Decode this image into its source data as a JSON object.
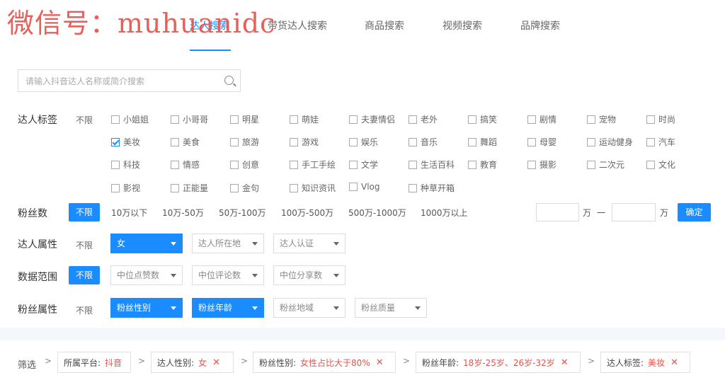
{
  "watermark": "微信号：muhuanidc",
  "tabs": [
    {
      "label": "达人搜索",
      "active": true
    },
    {
      "label": "带货达人搜索",
      "active": false
    },
    {
      "label": "商品搜索",
      "active": false
    },
    {
      "label": "视频搜索",
      "active": false
    },
    {
      "label": "品牌搜索",
      "active": false
    }
  ],
  "search": {
    "placeholder": "请输入抖音达人名称或简介搜索",
    "icon": "search-icon"
  },
  "tags": {
    "label": "达人标签",
    "nolimit": "不限",
    "items": [
      {
        "label": "小姐姐",
        "checked": false
      },
      {
        "label": "小哥哥",
        "checked": false
      },
      {
        "label": "明星",
        "checked": false
      },
      {
        "label": "萌娃",
        "checked": false
      },
      {
        "label": "夫妻情侣",
        "checked": false
      },
      {
        "label": "老外",
        "checked": false
      },
      {
        "label": "搞笑",
        "checked": false
      },
      {
        "label": "剧情",
        "checked": false
      },
      {
        "label": "宠物",
        "checked": false
      },
      {
        "label": "时尚",
        "checked": false
      },
      {
        "label": "美妆",
        "checked": true
      },
      {
        "label": "美食",
        "checked": false
      },
      {
        "label": "旅游",
        "checked": false
      },
      {
        "label": "游戏",
        "checked": false
      },
      {
        "label": "娱乐",
        "checked": false
      },
      {
        "label": "音乐",
        "checked": false
      },
      {
        "label": "舞蹈",
        "checked": false
      },
      {
        "label": "母婴",
        "checked": false
      },
      {
        "label": "运动健身",
        "checked": false
      },
      {
        "label": "汽车",
        "checked": false
      },
      {
        "label": "科技",
        "checked": false
      },
      {
        "label": "情感",
        "checked": false
      },
      {
        "label": "创意",
        "checked": false
      },
      {
        "label": "手工手绘",
        "checked": false
      },
      {
        "label": "文学",
        "checked": false
      },
      {
        "label": "生活百科",
        "checked": false
      },
      {
        "label": "教育",
        "checked": false
      },
      {
        "label": "摄影",
        "checked": false
      },
      {
        "label": "二次元",
        "checked": false
      },
      {
        "label": "文化",
        "checked": false
      },
      {
        "label": "影视",
        "checked": false
      },
      {
        "label": "正能量",
        "checked": false
      },
      {
        "label": "金句",
        "checked": false
      },
      {
        "label": "知识资讯",
        "checked": false
      },
      {
        "label": "Vlog",
        "checked": false
      },
      {
        "label": "种草开箱",
        "checked": false
      }
    ]
  },
  "fans": {
    "label": "粉丝数",
    "nolimit": "不限",
    "options": [
      "10万以下",
      "10万-50万",
      "50万-100万",
      "100万-500万",
      "500万-1000万",
      "1000万以上"
    ],
    "unit": "万",
    "dash": "一",
    "confirm": "确定"
  },
  "attr": {
    "label": "达人属性",
    "nolimit": "不限",
    "dropdowns": [
      {
        "label": "女",
        "active": true
      },
      {
        "label": "达人所在地",
        "active": false
      },
      {
        "label": "达人认证",
        "active": false
      }
    ]
  },
  "data_range": {
    "label": "数据范围",
    "nolimit": "不限",
    "dropdowns": [
      {
        "label": "中位点赞数",
        "active": false
      },
      {
        "label": "中位评论数",
        "active": false
      },
      {
        "label": "中位分享数",
        "active": false
      }
    ]
  },
  "fan_attr": {
    "label": "粉丝属性",
    "nolimit": "不限",
    "dropdowns": [
      {
        "label": "粉丝性别",
        "active": true
      },
      {
        "label": "粉丝年龄",
        "active": true
      },
      {
        "label": "粉丝地域",
        "active": false
      },
      {
        "label": "粉丝质量",
        "active": false
      }
    ]
  },
  "filters": {
    "label": "筛选",
    "sep": ">",
    "chips": [
      {
        "key": "所属平台:",
        "value": "抖音",
        "closable": false
      },
      {
        "key": "达人性别:",
        "value": "女",
        "closable": true
      },
      {
        "key": "粉丝性别:",
        "value": "女性占比大于80%",
        "closable": true
      },
      {
        "key": "粉丝年龄:",
        "value": "18岁-25岁、26岁-32岁",
        "closable": true
      },
      {
        "key": "达人标签:",
        "value": "美妆",
        "closable": true
      }
    ],
    "close": "✕"
  },
  "colors": {
    "accent": "#1a8cff",
    "danger": "#e5534b"
  }
}
